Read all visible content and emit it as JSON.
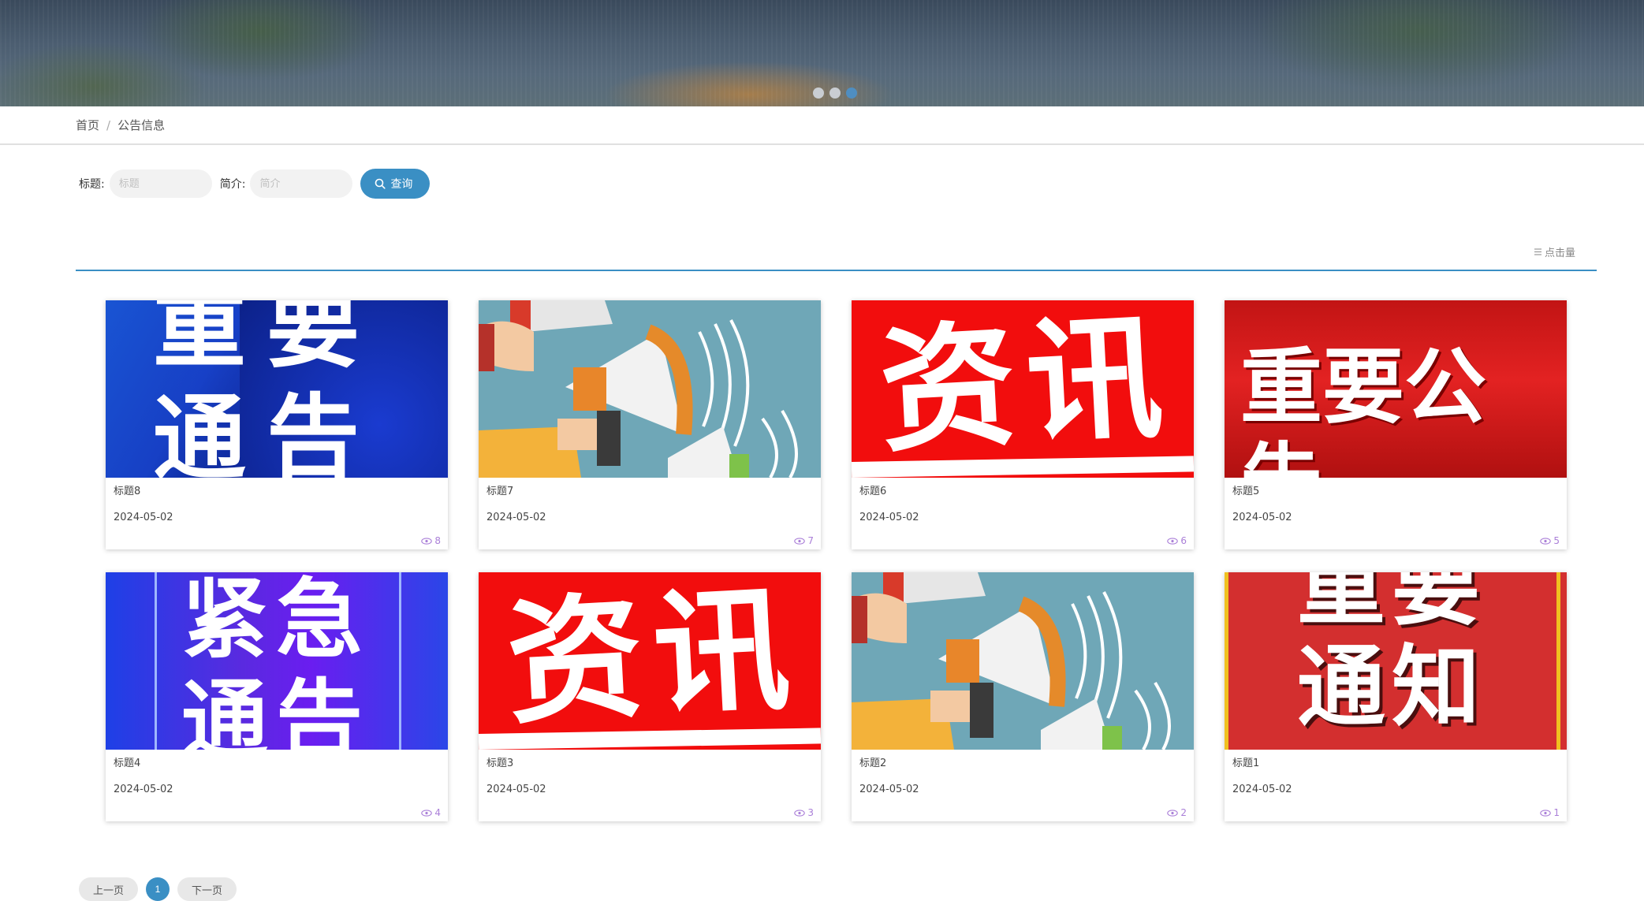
{
  "banner": {
    "slides": 3,
    "active_slide": 3
  },
  "breadcrumb": {
    "home": "首页",
    "separator": "/",
    "current": "公告信息"
  },
  "search": {
    "title_label": "标题:",
    "title_placeholder": "标题",
    "intro_label": "简介:",
    "intro_placeholder": "简介",
    "button_label": "查询"
  },
  "sort": {
    "label": "点击量"
  },
  "cards": [
    {
      "title": "标题8",
      "date": "2024-05-02",
      "views": "8",
      "image": "重要通告-blue"
    },
    {
      "title": "标题7",
      "date": "2024-05-02",
      "views": "7",
      "image": "megaphones"
    },
    {
      "title": "标题6",
      "date": "2024-05-02",
      "views": "6",
      "image": "资讯-red"
    },
    {
      "title": "标题5",
      "date": "2024-05-02",
      "views": "5",
      "image": "重要公告-red"
    },
    {
      "title": "标题4",
      "date": "2024-05-02",
      "views": "4",
      "image": "紧急通告-purple"
    },
    {
      "title": "标题3",
      "date": "2024-05-02",
      "views": "3",
      "image": "资讯-red"
    },
    {
      "title": "标题2",
      "date": "2024-05-02",
      "views": "2",
      "image": "megaphones"
    },
    {
      "title": "标题1",
      "date": "2024-05-02",
      "views": "1",
      "image": "重要通知-red"
    }
  ],
  "image_text": {
    "blue": "重要通告",
    "red": "资讯",
    "notice": "重要公告",
    "urgent": "紧急通告",
    "notify": "重要通知"
  },
  "pagination": {
    "prev": "上一页",
    "current": "1",
    "next": "下一页"
  },
  "colors": {
    "accent": "#3a8fc4",
    "view_icon": "#aa7fd8"
  }
}
